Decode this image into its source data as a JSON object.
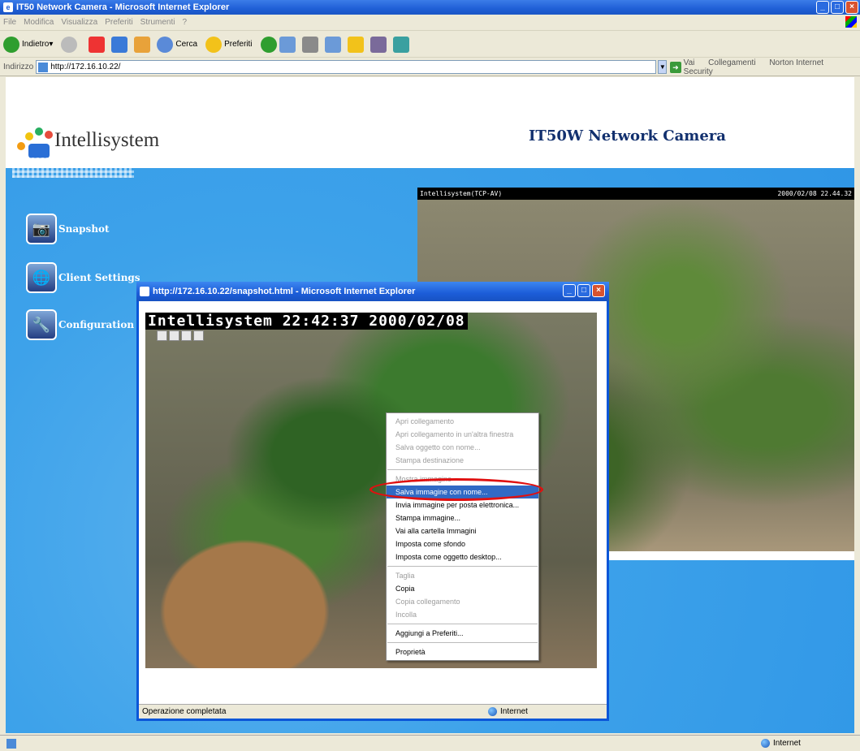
{
  "browser": {
    "title": "IT50 Network Camera - Microsoft Internet Explorer",
    "menu": [
      "File",
      "Modifica",
      "Visualizza",
      "Preferiti",
      "Strumenti",
      "?"
    ],
    "toolbar": {
      "back": "Indietro",
      "search": "Cerca",
      "favorites": "Preferiti"
    },
    "address": {
      "label": "Indirizzo",
      "url": "http://172.16.10.22/",
      "go": "Vai",
      "links": "Collegamenti",
      "norton": "Norton Internet Security"
    },
    "status": {
      "zone": "Internet"
    }
  },
  "page": {
    "logo_text": "Intellisystem",
    "camera_title": "IT50W Network Camera",
    "nav": [
      {
        "label": "Snapshot",
        "icon": "camera-icon"
      },
      {
        "label": "Client Settings",
        "icon": "globe-icon"
      },
      {
        "label": "Configuration",
        "icon": "tools-icon"
      }
    ],
    "live": {
      "left_caption": "Intellisystem(TCP-AV)",
      "right_caption": "2000/02/08 22.44.32"
    }
  },
  "popup": {
    "title": "http://172.16.10.22/snapshot.html - Microsoft Internet Explorer",
    "overlay": "Intellisystem 22:42:37 2000/02/08",
    "status_text": "Operazione completata",
    "zone": "Internet"
  },
  "context_menu": {
    "items": [
      {
        "label": "Apri collegamento",
        "disabled": true
      },
      {
        "label": "Apri collegamento in un'altra finestra",
        "disabled": true
      },
      {
        "label": "Salva oggetto con nome...",
        "disabled": true
      },
      {
        "label": "Stampa destinazione",
        "disabled": true
      },
      {
        "sep": true
      },
      {
        "label": "Mostra immagine",
        "disabled": true
      },
      {
        "label": "Salva immagine con nome...",
        "highlighted": true
      },
      {
        "label": "Invia immagine per posta elettronica..."
      },
      {
        "label": "Stampa immagine..."
      },
      {
        "label": "Vai alla cartella Immagini"
      },
      {
        "label": "Imposta come sfondo"
      },
      {
        "label": "Imposta come oggetto desktop..."
      },
      {
        "sep": true
      },
      {
        "label": "Taglia",
        "disabled": true
      },
      {
        "label": "Copia"
      },
      {
        "label": "Copia collegamento",
        "disabled": true
      },
      {
        "label": "Incolla",
        "disabled": true
      },
      {
        "sep": true
      },
      {
        "label": "Aggiungi a Preferiti..."
      },
      {
        "sep": true
      },
      {
        "label": "Proprietà"
      }
    ]
  },
  "colors": {
    "page_bg": "#3da2ea",
    "title_blue": "#12306e",
    "highlight": "#316ac5",
    "annotation_ring": "#e01010"
  }
}
